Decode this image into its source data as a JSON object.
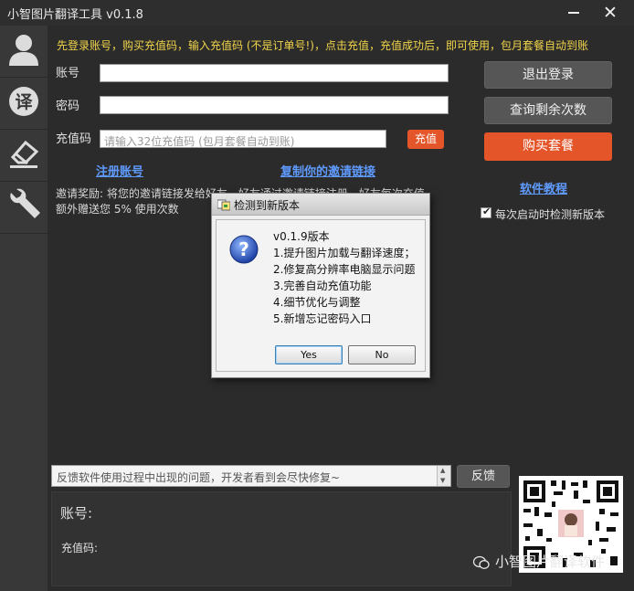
{
  "window": {
    "title": "小智图片翻译工具 v0.1.8"
  },
  "sidebar": {
    "items": [
      {
        "icon": "user-icon"
      },
      {
        "icon": "translate-icon",
        "glyph": "译"
      },
      {
        "icon": "eraser-icon"
      },
      {
        "icon": "wrench-icon"
      }
    ]
  },
  "notice": "先登录账号，购买充值码，输入充值码 (不是订单号!)，点击充值，充值成功后，即可使用，包月套餐自动到账",
  "form": {
    "account_label": "账号",
    "account_value": "",
    "password_label": "密码",
    "password_value": "",
    "code_label": "充值码",
    "code_placeholder": "请输入32位充值码 (包月套餐自动到账)",
    "recharge_button": "充值"
  },
  "links": {
    "register": "注册账号",
    "copy_invite": "复制你的邀请链接",
    "tutorial": "软件教程"
  },
  "invite": {
    "line1": "邀请奖励: 将您的邀请链接发给好友，好友通过邀请链接注册，好友每次充值，",
    "line2": "额外赠送您 5% 使用次数"
  },
  "buttons": {
    "logout": "退出登录",
    "query_remaining": "查询剩余次数",
    "buy_plan": "购买套餐",
    "feedback": "反馈"
  },
  "check_update": {
    "label": "每次启动时检测新版本",
    "checked": true
  },
  "dialog": {
    "title": "检测到新版本",
    "lines": [
      "v0.1.9版本",
      "1.提升图片加载与翻译速度；",
      "2.修复高分辨率电脑显示问题",
      "3.完善自动充值功能",
      "4.细节优化与调整",
      "5.新增忘记密码入口"
    ],
    "yes_label": "Yes",
    "no_label": "No"
  },
  "feedback": {
    "placeholder": "反馈软件使用过程中出现的问题，开发者看到会尽快修复~"
  },
  "info": {
    "account_label": "账号:",
    "code_label": "充值码:"
  },
  "watermark": "小智图片翻译软件",
  "colors": {
    "accent_orange": "#e4562a",
    "notice_yellow": "#f0d44a",
    "link_blue": "#5f9bff",
    "background": "#2b2b2b"
  }
}
